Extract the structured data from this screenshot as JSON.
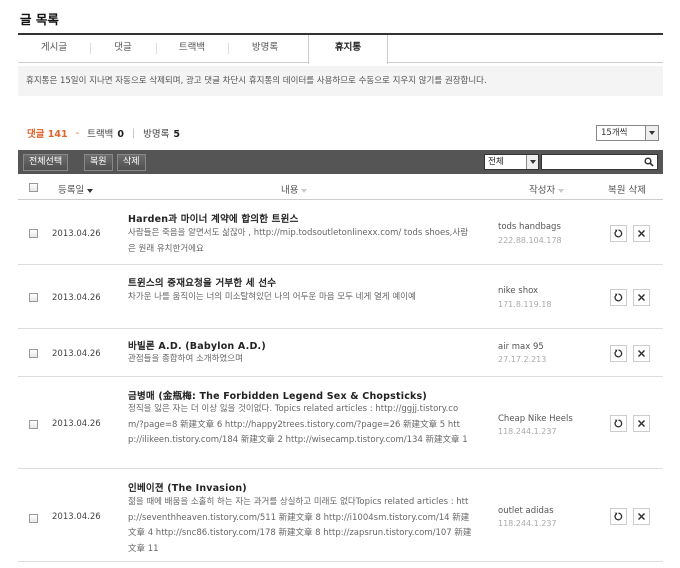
{
  "page": {
    "title": "글 목록"
  },
  "tabs": [
    {
      "label": "게시글"
    },
    {
      "label": "댓글"
    },
    {
      "label": "트랙백"
    },
    {
      "label": "방명록"
    },
    {
      "label": "휴지통"
    }
  ],
  "notice": "휴지통은 15일이 지나면 자동으로 삭제되며, 광고 댓글 차단시 휴지통의 데이터를 사용하므로 수동으로 지우지 않기를 권장합니다.",
  "counts": {
    "comment_label": "댓글",
    "comment_value": "141",
    "dash": "-",
    "trackback_label": "트랙백",
    "trackback_value": "0",
    "sep": "|",
    "guestbook_label": "방명록",
    "guestbook_value": "5"
  },
  "per_page": {
    "selected": "15개씩"
  },
  "toolbar": {
    "select_all": "전체선택",
    "restore": "복원",
    "delete": "삭제",
    "filter_selected": "전체",
    "search_value": ""
  },
  "header": {
    "date": "등록일",
    "content": "내용",
    "author": "작성자",
    "actions": "복원 삭제"
  },
  "rows": [
    {
      "date": "2013.04.26",
      "title": "Harden과 마이너 계약에 합의한 트윈스",
      "body": "사람들은 죽음을 알면서도 삶잖아 , http://mip.todsoutletonlinexx.com/ tods shoes,사람은 원래 유치한거에요",
      "author": "tods handbags",
      "ip": "222.88.104.178"
    },
    {
      "date": "2013.04.26",
      "title": "트윈스의 중재요청을 거부한 세 선수",
      "body": "차가운 나를 움직이는 너의 미소탈혀있던 나의 어두운 마음 모두 네게 열게 예이예",
      "author": "nike shox",
      "ip": "171.8.119.18"
    },
    {
      "date": "2013.04.26",
      "title": "바빌론 A.D. (Babylon A.D.)",
      "body": "관점들을 종합하여 소개하였으며",
      "author": "air max 95",
      "ip": "27.17.2.213"
    },
    {
      "date": "2013.04.26",
      "title": "금병매 (金瓶梅: The Forbidden Legend Sex & Chopsticks)",
      "body": "정직을 잃은 자는 더 이상 잃을 것이없다. Topics related articles : http://ggjj.tistory.com/?page=8 新建文章 6 http://happy2trees.tistory.com/?page=26 新建文章 5 http://ilikeen.tistory.com/184 新建文章 2 http://wisecamp.tistory.com/134 新建文章 1",
      "author": "Cheap Nike Heels",
      "ip": "118.244.1.237"
    },
    {
      "date": "2013.04.26",
      "title": "인베이젼 (The Invasion)",
      "body": "젊을 때에 배움을 소홀히 하는 자는 과거를 상실하고 미래도 없다Topics related articles : http://seventhheaven.tistory.com/511 新建文章 8 http://i1004sm.tistory.com/14 新建文章 4 http://snc86.tistory.com/178 新建文章 8 http://zapsrun.tistory.com/107 新建文章 11",
      "author": "outlet adidas",
      "ip": "118.244.1.237"
    }
  ]
}
